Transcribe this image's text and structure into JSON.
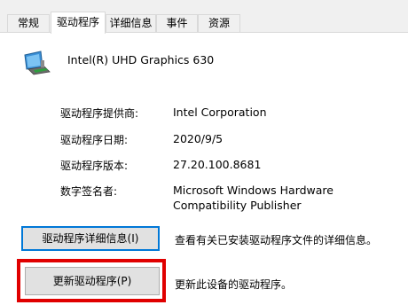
{
  "tabs": [
    {
      "label": "常规"
    },
    {
      "label": "驱动程序"
    },
    {
      "label": "详细信息"
    },
    {
      "label": "事件"
    },
    {
      "label": "资源"
    }
  ],
  "device": {
    "icon": "display-adapter-icon",
    "name": "Intel(R) UHD Graphics 630"
  },
  "properties": {
    "provider_label": "驱动程序提供商:",
    "provider_value": "Intel Corporation",
    "date_label": "驱动程序日期:",
    "date_value": "2020/9/5",
    "version_label": "驱动程序版本:",
    "version_value": "27.20.100.8681",
    "signer_label": "数字签名者:",
    "signer_value_line1": "Microsoft Windows Hardware",
    "signer_value_line2": "Compatibility Publisher"
  },
  "buttons": {
    "details_label": "驱动程序详细信息(I)",
    "details_desc": "查看有关已安装驱动程序文件的详细信息。",
    "update_label": "更新驱动程序(P)",
    "update_desc": "更新此设备的驱动程序。"
  },
  "colors": {
    "highlight": "#e00000",
    "focus": "#0078d7"
  }
}
